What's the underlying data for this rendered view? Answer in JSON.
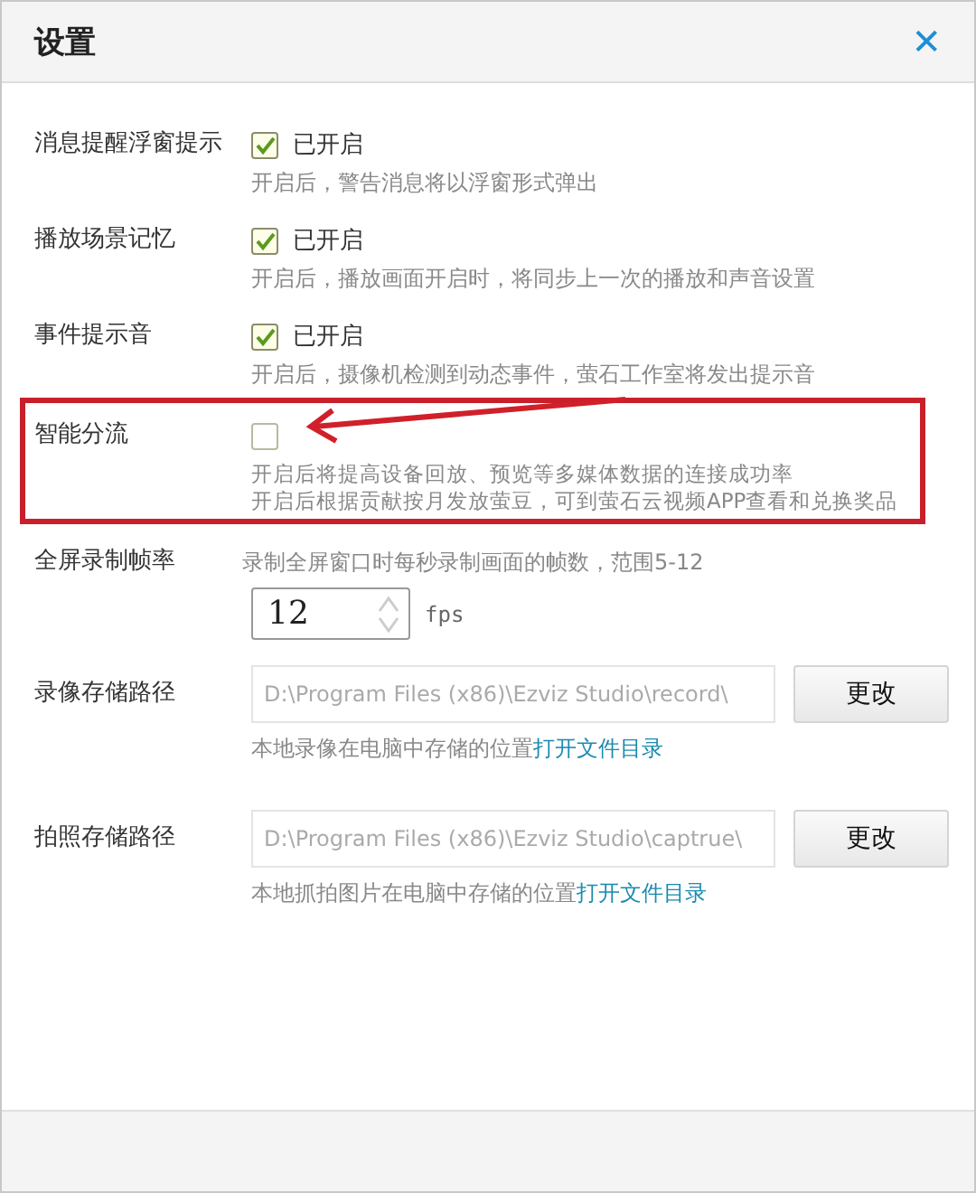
{
  "window": {
    "title": "设置",
    "close": "✕"
  },
  "settings": [
    {
      "kind": "toggle",
      "label": "消息提醒浮窗提示",
      "checked": true,
      "state_text": "已开启",
      "descriptions": [
        "开启后，警告消息将以浮窗形式弹出"
      ],
      "highlighted": false
    },
    {
      "kind": "toggle",
      "label": "播放场景记忆",
      "checked": true,
      "state_text": "已开启",
      "descriptions": [
        "开启后，播放画面开启时，将同步上一次的播放和声音设置"
      ],
      "highlighted": false
    },
    {
      "kind": "toggle",
      "label": "事件提示音",
      "checked": true,
      "state_text": "已开启",
      "descriptions": [
        "开启后，摄像机检测到动态事件，萤石工作室将发出提示音"
      ],
      "highlighted": false
    },
    {
      "kind": "toggle",
      "label": "智能分流",
      "checked": false,
      "descriptions": [
        "开启后将提高设备回放、预览等多媒体数据的连接成功率",
        "开启后根据贡献按月发放萤豆，可到萤石云视频APP查看和兑换奖品"
      ],
      "highlighted": true
    },
    {
      "kind": "number",
      "label": "全屏录制帧率",
      "description": "录制全屏窗口时每秒录制画面的帧数，范围5-12",
      "value": "12",
      "unit": "fps"
    },
    {
      "kind": "path",
      "label": "录像存储路径",
      "value": "D:\\Program Files (x86)\\Ezviz Studio\\record\\",
      "button": "更改",
      "note": "本地录像在电脑中存储的位置",
      "link": "打开文件目录"
    },
    {
      "kind": "path",
      "label": "拍照存储路径",
      "value": "D:\\Program Files (x86)\\Ezviz Studio\\captrue\\",
      "button": "更改",
      "note": "本地抓拍图片在电脑中存储的位置",
      "link": "打开文件目录"
    }
  ]
}
